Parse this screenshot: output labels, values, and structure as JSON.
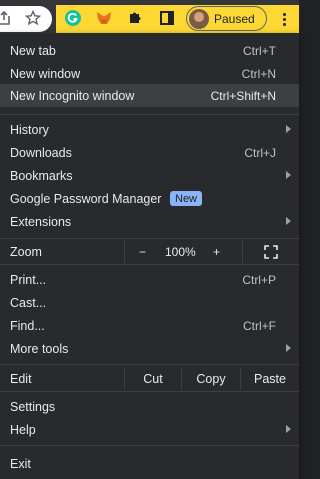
{
  "profile": {
    "label": "Paused"
  },
  "menu": {
    "new_tab": {
      "label": "New tab",
      "shortcut": "Ctrl+T"
    },
    "new_window": {
      "label": "New window",
      "shortcut": "Ctrl+N"
    },
    "new_incognito": {
      "label": "New Incognito window",
      "shortcut": "Ctrl+Shift+N"
    },
    "history": {
      "label": "History"
    },
    "downloads": {
      "label": "Downloads",
      "shortcut": "Ctrl+J"
    },
    "bookmarks": {
      "label": "Bookmarks"
    },
    "password_manager": {
      "label": "Google Password Manager",
      "badge": "New"
    },
    "extensions": {
      "label": "Extensions"
    },
    "zoom": {
      "label": "Zoom",
      "minus": "−",
      "value": "100%",
      "plus": "+"
    },
    "print": {
      "label": "Print...",
      "shortcut": "Ctrl+P"
    },
    "cast": {
      "label": "Cast..."
    },
    "find": {
      "label": "Find...",
      "shortcut": "Ctrl+F"
    },
    "more_tools": {
      "label": "More tools"
    },
    "edit": {
      "label": "Edit",
      "cut": "Cut",
      "copy": "Copy",
      "paste": "Paste"
    },
    "settings": {
      "label": "Settings"
    },
    "help": {
      "label": "Help"
    },
    "exit": {
      "label": "Exit"
    }
  },
  "colors": {
    "accent": "#fdd835",
    "menu_bg": "#292a2d",
    "highlight": "#3c4043",
    "badge": "#8ab4f8"
  },
  "icons": [
    "share-icon",
    "star-icon",
    "grammarly-icon",
    "metamask-icon",
    "puzzle-icon",
    "sidepanel-icon",
    "avatar",
    "kebab-menu-icon",
    "fullscreen-icon"
  ]
}
